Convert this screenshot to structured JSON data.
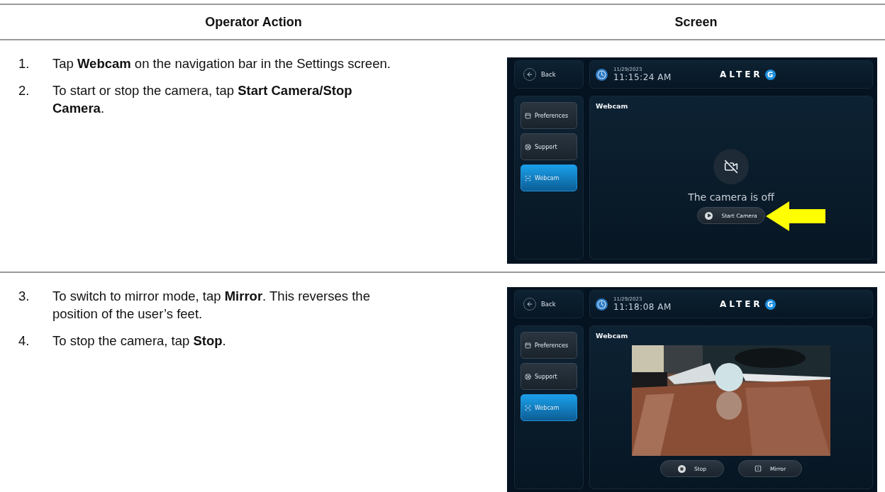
{
  "columns": [
    "Operator Action",
    "Screen"
  ],
  "rows": [
    {
      "steps": [
        {
          "number": "1.",
          "text": "Tap **Webcam** on the navigation bar in the Settings screen."
        },
        {
          "number": "2.",
          "text": "To start or stop the camera, tap **Start Camera/Stop Camera**."
        }
      ],
      "screen": {
        "back": "Back",
        "date": "11/29/2023",
        "time": "11:15:24 AM",
        "logo": "ALTER",
        "logo_mark": "G",
        "nav": [
          {
            "label": "Preferences",
            "kind": "preferences",
            "selected": false
          },
          {
            "label": "Support",
            "kind": "support",
            "selected": false
          },
          {
            "label": "Webcam",
            "kind": "webcam",
            "selected": true
          }
        ],
        "title": "Webcam",
        "kind": "camera_off",
        "message": "The camera is off",
        "callout": true,
        "buttons": [
          {
            "label": "Start Camera",
            "kind": "play"
          }
        ]
      }
    },
    {
      "steps": [
        {
          "number": "3.",
          "text": "To switch to mirror mode, tap **Mirror**. This reverses the position of the user’s feet."
        },
        {
          "number": "4.",
          "text": "To stop the camera, tap **Stop**."
        }
      ],
      "screen": {
        "back": "Back",
        "date": "11/29/2023",
        "time": "11:18:08 AM",
        "logo": "ALTER",
        "logo_mark": "G",
        "nav": [
          {
            "label": "Preferences",
            "kind": "preferences",
            "selected": false
          },
          {
            "label": "Support",
            "kind": "support",
            "selected": false
          },
          {
            "label": "Webcam",
            "kind": "webcam",
            "selected": true
          }
        ],
        "title": "Webcam",
        "kind": "live",
        "buttons": [
          {
            "label": "Stop",
            "kind": "stop"
          },
          {
            "label": "Mirror",
            "kind": "mirror"
          }
        ]
      }
    }
  ]
}
